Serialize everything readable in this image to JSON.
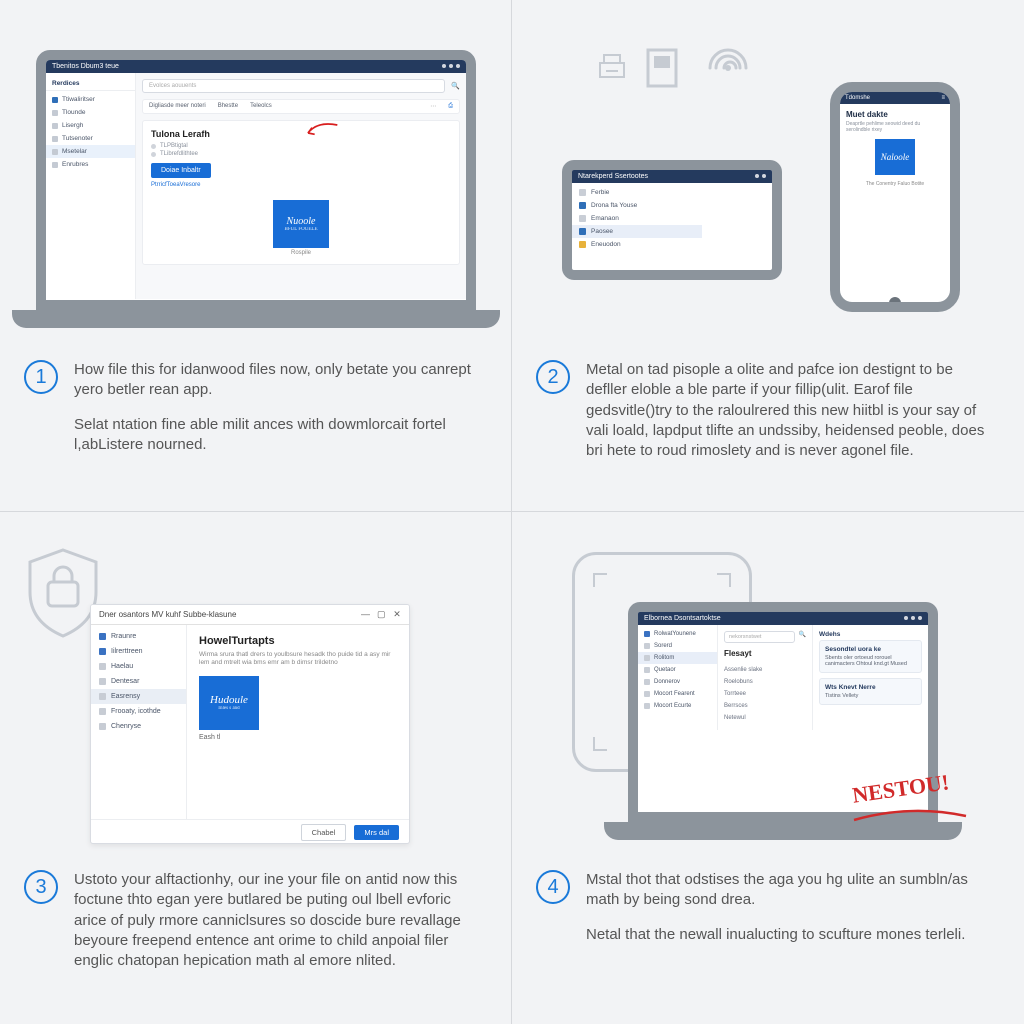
{
  "panel1": {
    "step_num": "1",
    "para1": "How file this for idanwood files now, only betate you canrept yero betler rean app.",
    "para2": "Selat ntation fine able milit ances with dowmlorcait fortel l,abListere nourned.",
    "titlebar": "Tbenitos Dbum3 teue",
    "sidebar_header": "Rerdices",
    "sidebar_items": [
      "Ttiwaliritser",
      "Tlounde",
      "Lisergh",
      "Tutsenoter",
      "Msetelar",
      "Enrubres"
    ],
    "search_placeholder": "Evolces aouuents",
    "toolbar": [
      "Digliasde meer noteri",
      "Bhestte",
      "Teleolcs"
    ],
    "content_title": "Tulona Lerafh",
    "meta1": "TLPBtigtal",
    "meta2": "TLibrefdlithtee",
    "primary_btn": "Doiae Inbaltr",
    "link_text": "PtrricfToeaVresore",
    "logo_text": "Nuoole",
    "logo_sub": "BFUL FOUELE",
    "caption": "Rospile"
  },
  "panel2": {
    "step_num": "2",
    "para1": "Metal on tad pisople a olite and pafce ion destignt to be defller eloble a ble parte if your fillip(ulit. Earof file gedsvitle()try to the raloulrered this new hiitbl is your say of vali loald, lapdput tlifte an undssiby, heidensed peoble, does bri hete to roud rimoslety and is never agonel file.",
    "tablet_title": "Ntarekperd Ssertootes",
    "tablet_items": [
      "Ferbie",
      "Drona fta Youse",
      "Emanaon",
      "Paosee",
      "Eneuodon"
    ],
    "phone_title": "Tdomshe",
    "phone_head": "Muet dakte",
    "phone_sub": "Deaprtle pehlime seowid deed du serolindble rixey",
    "phone_logo": "Naloole",
    "phone_caption": "The Conentry Faluo Botite"
  },
  "panel3": {
    "step_num": "3",
    "para1": "Ustoto your alftactionhy, our ine your file on antid now this foctune thto egan yere butlared be puting oul lbell evforic arice of puly rmore canniclsures so doscide bure revallage beyoure freepend entence ant orime to child anpoial filer englic chatopan hepication math al emore nlited.",
    "dialog_title": "Dner osantors MV kuhf Subbe-klasune",
    "nav_items": [
      "Rraunre",
      "Iilrerttreen",
      "Haelau",
      "Dentesar",
      "Easrensy",
      "Frooaty, icothde",
      "Chenryse"
    ],
    "main_title": "HowelTurtapts",
    "main_desc": "Wirma srura thatl drers to youlbsure hesadk tho puide tid a asy mir lem and mtrelt wia bms emr am b dimsr trildetno",
    "thumb_text": "Hudoule",
    "thumb_sub": "Inles s and",
    "thumb_caption": "Eash tl",
    "btn_cancel": "Chabel",
    "btn_ok": "Mrs dal"
  },
  "panel4": {
    "step_num": "4",
    "para1": "Mstal thot that odstises the aga you hg ulite an sumbln/as math by being sond drea.",
    "para2": "Netal that the newall inualucting to scufture mones terleli.",
    "titlebar": "Elbornea Dsontsartoktse",
    "search_placeholder": "nekorsnstwet",
    "sidebar": [
      "RolwatYounene",
      "Sorerd",
      "Rolitom",
      "Quetaor",
      "Donnerov",
      "Mocort Fearent",
      "Mocort Ecurte"
    ],
    "mid_title": "Flesayt",
    "mid_items": [
      "Assenlie slake",
      "Roelobuns",
      "Torrteee",
      "Berrsces",
      "Netewul"
    ],
    "right_title": "Wdehs",
    "card1_title": "Sesondtel uora ke",
    "card1_body": "Sbents oler ortoeud rorouel canimacters Ohtoul knd.gt Mused",
    "card2_title": "Wts Knevt Nerre",
    "card2_body": "Tistins Vellety",
    "hand_note": "NESTOU!"
  }
}
